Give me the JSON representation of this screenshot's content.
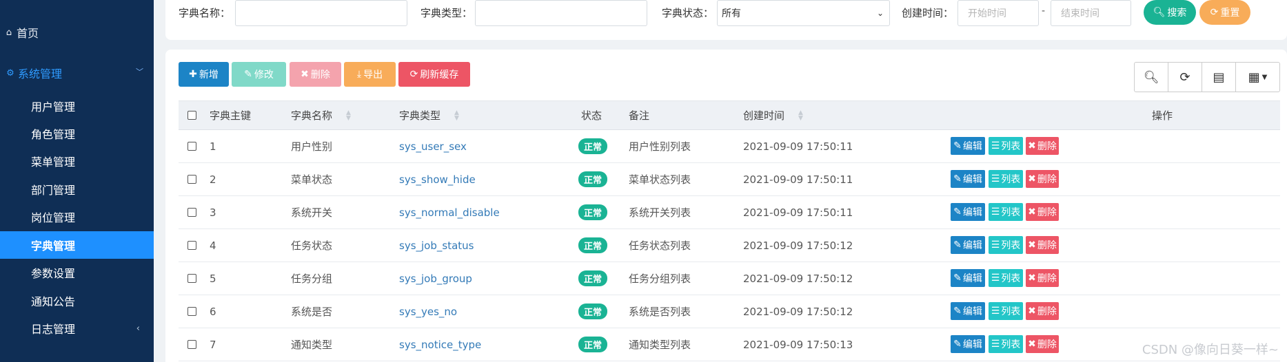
{
  "sidebar": {
    "home": "首页",
    "group": "系统管理",
    "items": [
      {
        "label": "用户管理"
      },
      {
        "label": "角色管理"
      },
      {
        "label": "菜单管理"
      },
      {
        "label": "部门管理"
      },
      {
        "label": "岗位管理"
      },
      {
        "label": "字典管理",
        "active": true
      },
      {
        "label": "参数设置"
      },
      {
        "label": "通知公告"
      },
      {
        "label": "日志管理"
      }
    ]
  },
  "search": {
    "name_label": "字典名称：",
    "type_label": "字典类型：",
    "status_label": "字典状态：",
    "status_value": "所有",
    "time_label": "创建时间：",
    "start_placeholder": "开始时间",
    "end_placeholder": "结束时间",
    "dash": "-",
    "search_btn": "搜索",
    "reset_btn": "重置"
  },
  "toolbar": {
    "add": "新增",
    "edit": "修改",
    "delete": "删除",
    "export": "导出",
    "refresh_cache": "刷新缓存"
  },
  "table": {
    "headers": [
      "字典主键",
      "字典名称",
      "字典类型",
      "状态",
      "备注",
      "创建时间",
      "操作"
    ],
    "rows": [
      {
        "id": "1",
        "name": "用户性别",
        "type": "sys_user_sex",
        "status": "正常",
        "remark": "用户性别列表",
        "time": "2021-09-09 17:50:11"
      },
      {
        "id": "2",
        "name": "菜单状态",
        "type": "sys_show_hide",
        "status": "正常",
        "remark": "菜单状态列表",
        "time": "2021-09-09 17:50:11"
      },
      {
        "id": "3",
        "name": "系统开关",
        "type": "sys_normal_disable",
        "status": "正常",
        "remark": "系统开关列表",
        "time": "2021-09-09 17:50:11"
      },
      {
        "id": "4",
        "name": "任务状态",
        "type": "sys_job_status",
        "status": "正常",
        "remark": "任务状态列表",
        "time": "2021-09-09 17:50:12"
      },
      {
        "id": "5",
        "name": "任务分组",
        "type": "sys_job_group",
        "status": "正常",
        "remark": "任务分组列表",
        "time": "2021-09-09 17:50:12"
      },
      {
        "id": "6",
        "name": "系统是否",
        "type": "sys_yes_no",
        "status": "正常",
        "remark": "系统是否列表",
        "time": "2021-09-09 17:50:12"
      },
      {
        "id": "7",
        "name": "通知类型",
        "type": "sys_notice_type",
        "status": "正常",
        "remark": "通知类型列表",
        "time": "2021-09-09 17:50:13"
      }
    ],
    "op_edit": "编辑",
    "op_list": "列表",
    "op_delete": "删除"
  },
  "colors": {
    "sidebar_bg": "#0f2e55",
    "active_item": "#1e90ff",
    "primary": "#1c84c6",
    "success": "#1ab394",
    "info": "#23c6c8",
    "danger": "#ed5565",
    "warning": "#f8ac59"
  },
  "watermark": "CSDN @像向日葵一样~"
}
